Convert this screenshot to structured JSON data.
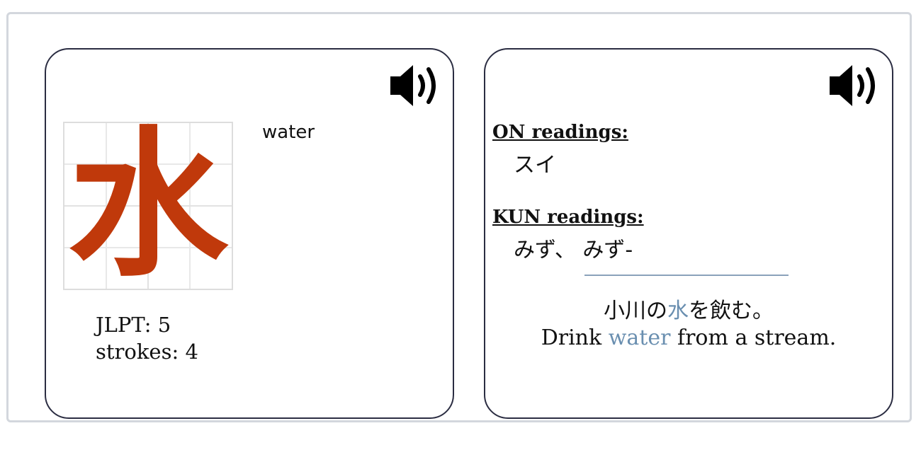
{
  "kanji_card": {
    "character": "水",
    "meaning": "water",
    "jlpt_label": "JLPT:",
    "jlpt_value": "5",
    "strokes_label": "strokes:",
    "strokes_value": "4",
    "audio_icon": "speaker-icon"
  },
  "readings_card": {
    "on_heading": "ON readings:",
    "on_reading": "スイ",
    "kun_heading": "KUN readings:",
    "kun_reading": "みず、 みず-",
    "audio_icon": "speaker-icon",
    "example_jp": {
      "before": "小川の",
      "highlight": "水",
      "after": "を飲む。"
    },
    "example_en": {
      "before": "Drink ",
      "highlight": "water",
      "after": " from a stream."
    }
  },
  "colors": {
    "kanji": "#c0390b",
    "highlight": "#6a8fb0",
    "card_border": "#2b2d42",
    "outer_border": "#d3d7dd",
    "divider": "#8aa2ba"
  }
}
